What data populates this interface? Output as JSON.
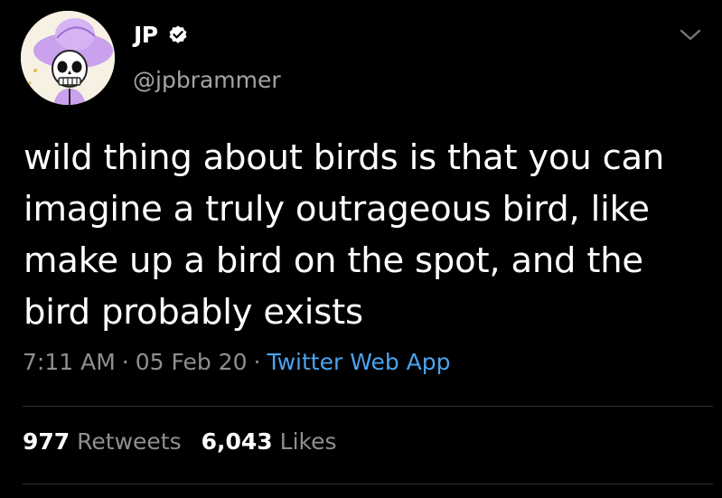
{
  "author": {
    "display_name": "JP",
    "handle": "@jpbrammer",
    "verified": true,
    "avatar_icon": "skull-avatar",
    "verified_icon": "verified-badge-icon"
  },
  "tweet": {
    "text": "wild thing about birds is that you can imagine a truly outrageous bird, like make up a bird on the spot, and the bird probably exists"
  },
  "meta": {
    "time": "7:11 AM",
    "date": "05 Feb 20",
    "separator": "·",
    "source": "Twitter Web App"
  },
  "stats": {
    "retweets_count": "977",
    "retweets_label": "Retweets",
    "likes_count": "6,043",
    "likes_label": "Likes"
  },
  "colors": {
    "background": "#000000",
    "text": "#ffffff",
    "muted": "#8f8f8f",
    "link": "#4aa3ee",
    "divider": "#2d2d2d"
  }
}
